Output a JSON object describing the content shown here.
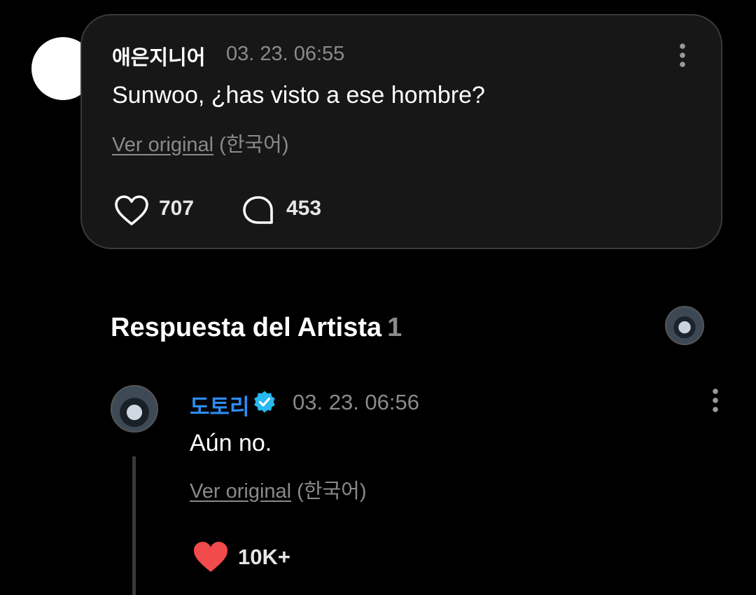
{
  "colors": {
    "background": "#000000",
    "card_background": "#171717",
    "card_border": "#3a3a3a",
    "muted_text": "#8a8a8a",
    "artist_name": "#2f8cf2",
    "verified_badge": "#27b8f0",
    "liked_heart": "#f24b4b"
  },
  "comment": {
    "author": "애은지니어",
    "timestamp": "03. 23. 06:55",
    "text": "Sunwoo, ¿has visto a ese hombre?",
    "view_original_label": "Ver original",
    "original_language": "(한국어)",
    "likes": "707",
    "replies": "453",
    "icons": {
      "more": "more-vertical-icon",
      "like": "heart-outline-icon",
      "reply": "speech-bubble-icon"
    }
  },
  "artist_section": {
    "title": "Respuesta del Artista",
    "count": "1"
  },
  "artist_reply": {
    "author": "도토리",
    "verified": true,
    "timestamp": "03. 23. 06:56",
    "text": "Aún no.",
    "view_original_label": "Ver original",
    "original_language": "(한국어)",
    "likes": "10K+",
    "liked": true,
    "icons": {
      "more": "more-vertical-icon",
      "verified": "verified-badge-icon",
      "like": "heart-filled-icon"
    }
  }
}
